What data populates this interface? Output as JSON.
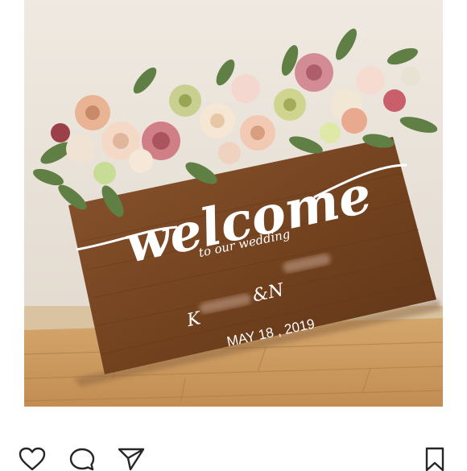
{
  "photo": {
    "sign": {
      "headline": "welcome",
      "subline": "to our wedding",
      "names_left": "K",
      "names_mid": "&N",
      "date": "MAY 18 , 2019"
    }
  },
  "actions": {
    "like_icon": "heart-icon",
    "comment_icon": "comment-icon",
    "share_icon": "send-icon",
    "save_icon": "bookmark-icon"
  },
  "colors": {
    "wood": "#7a4a2a",
    "wall": "#ece5dc",
    "floor": "#c99a63",
    "lettering": "#ffffff",
    "icon": "#262626"
  }
}
